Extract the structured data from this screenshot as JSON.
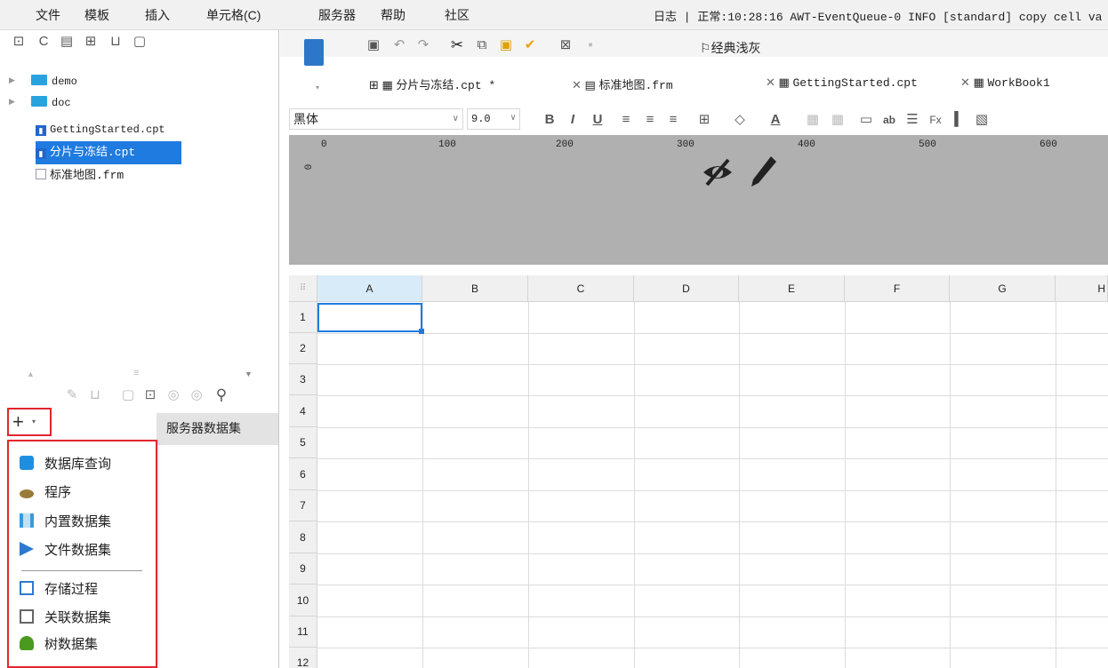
{
  "menu": [
    "文件",
    "模板",
    "插入",
    "单元格(C)",
    "服务器",
    "帮助",
    "社区"
  ],
  "log_text": "日志 | 正常:10:28:16 AWT-EventQueue-0 INFO [standard] copy cell va",
  "tree": {
    "items": [
      {
        "label": "demo",
        "type": "folder"
      },
      {
        "label": "doc",
        "type": "folder"
      },
      {
        "label": "GettingStarted.cpt",
        "type": "cpt"
      },
      {
        "label": "分片与冻结.cpt",
        "type": "cpt",
        "selected": true
      },
      {
        "label": "标准地图.frm",
        "type": "frm"
      }
    ]
  },
  "toolbar": {
    "theme_label": "经典浅灰"
  },
  "tabs": [
    {
      "label": "分片与冻结.cpt *"
    },
    {
      "label": "标准地图.frm"
    },
    {
      "label": "GettingStarted.cpt"
    },
    {
      "label": "WorkBook1"
    }
  ],
  "format": {
    "font": "黑体",
    "size": "9.0"
  },
  "ruler": {
    "marks": [
      "0",
      "100",
      "200",
      "300",
      "400",
      "500",
      "600"
    ],
    "v_mark": "0"
  },
  "dataset": {
    "server_tab": "服务器数据集",
    "menu": [
      "数据库查询",
      "程序",
      "内置数据集",
      "文件数据集",
      "存储过程",
      "关联数据集",
      "树数据集"
    ]
  },
  "grid": {
    "columns": [
      "A",
      "B",
      "C",
      "D",
      "E",
      "F",
      "G",
      "H"
    ],
    "rows": [
      "1",
      "2",
      "3",
      "4",
      "5",
      "6",
      "7",
      "8",
      "9",
      "10",
      "11",
      "12"
    ],
    "active_col": "A",
    "corner": "⠿"
  },
  "colors": {
    "accent": "#1f7be0",
    "highlight_box": "#e0262e",
    "folder": "#29a3e0"
  }
}
